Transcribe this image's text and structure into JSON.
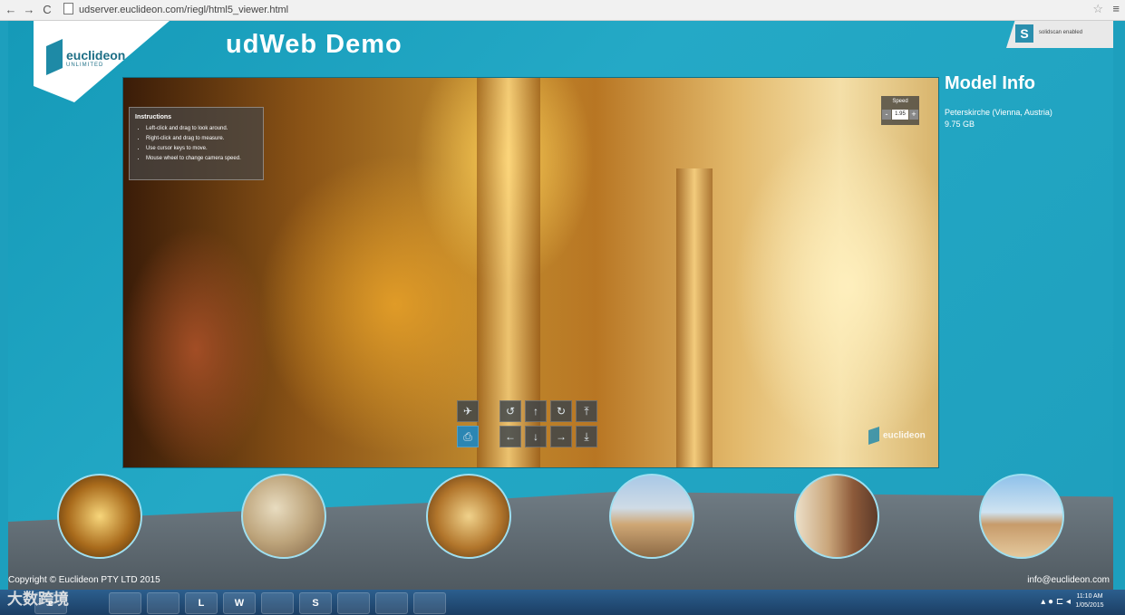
{
  "browser": {
    "back": "←",
    "forward": "→",
    "reload": "C",
    "url": "udserver.euclideon.com/riegl/html5_viewer.html",
    "star": "☆",
    "menu": "≡"
  },
  "header": {
    "logo_name": "euclideon",
    "logo_sub": "UNLIMITED",
    "title": "udWeb Demo",
    "badge_letter": "S",
    "badge_text": "solidscan enabled"
  },
  "instructions": {
    "title": "Instructions",
    "items": [
      "Left-click and drag to look around.",
      "Right-click and drag to measure.",
      "Use cursor keys to move.",
      "Mouse wheel to change camera speed."
    ]
  },
  "speed": {
    "label": "Speed",
    "minus": "-",
    "value": "1.95",
    "plus": "+"
  },
  "controls": {
    "icons": [
      "plane-icon",
      "camera-icon",
      "rotate-left-icon",
      "move-up-icon",
      "rotate-right-icon",
      "ascend-icon",
      "move-left-icon",
      "move-down-icon",
      "move-right-icon",
      "descend-icon"
    ],
    "glyphs": [
      "✈",
      "⎙",
      "↺",
      "↑",
      "↻",
      "⤒",
      "←",
      "↓",
      "→",
      "⤓"
    ]
  },
  "watermark": "euclideon",
  "model_info": {
    "title": "Model Info",
    "name": "Peterskirche (Vienna, Austria)",
    "size": "9.75 GB"
  },
  "footer": {
    "copyright": "Copyright © Euclideon PTY LTD 2015",
    "email": "info@euclideon.com"
  },
  "taskbar": {
    "apps": [
      "e",
      "",
      "",
      "L",
      "W",
      "",
      "S",
      "",
      "",
      ""
    ],
    "tray": "▴ ● ⊏ ◂",
    "time": "11:10 AM",
    "date": "1/05/2015",
    "overlay_text": "大数跨境"
  }
}
